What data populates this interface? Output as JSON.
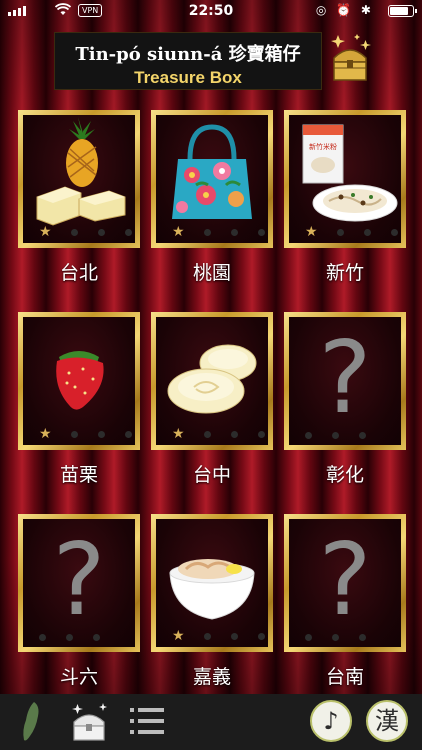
{
  "status_bar": {
    "time": "22:50",
    "vpn": "VPN",
    "right_icons": "◎ ⏰ ✱"
  },
  "header": {
    "title_line1": "Tin-pó siunn-á 珍寶箱仔",
    "title_line2": "Treasure Box"
  },
  "cards": [
    {
      "label": "台北",
      "unlocked": true,
      "item": "pineapple-cake"
    },
    {
      "label": "桃園",
      "unlocked": true,
      "item": "floral-tote-bag"
    },
    {
      "label": "新竹",
      "unlocked": true,
      "item": "rice-noodles"
    },
    {
      "label": "苗栗",
      "unlocked": true,
      "item": "strawberry"
    },
    {
      "label": "台中",
      "unlocked": true,
      "item": "sun-cake"
    },
    {
      "label": "彰化",
      "unlocked": false,
      "placeholder": "?"
    },
    {
      "label": "斗六",
      "unlocked": false,
      "placeholder": "?"
    },
    {
      "label": "嘉義",
      "unlocked": true,
      "item": "turkey-rice"
    },
    {
      "label": "台南",
      "unlocked": false,
      "placeholder": "?"
    }
  ],
  "packaging_text": "新竹米粉",
  "bottom_nav": {
    "music_symbol": "♪",
    "language_symbol": "漢"
  },
  "colors": {
    "curtain": "#7a0a16",
    "gold": "#e5c25a",
    "nav_bg": "#1c1c1c"
  }
}
